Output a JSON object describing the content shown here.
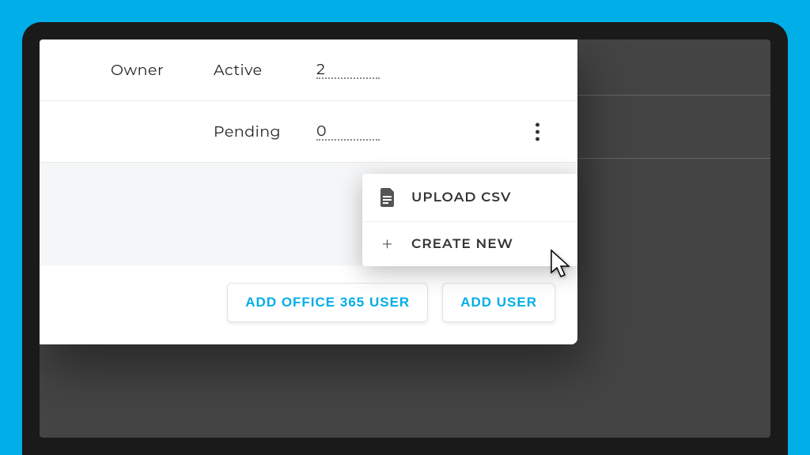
{
  "rows": [
    {
      "role": "Owner",
      "status": "Active",
      "count": "2",
      "kebab": false
    },
    {
      "role": "",
      "status": "Pending",
      "count": "0",
      "kebab": true
    }
  ],
  "dropdown": {
    "items": [
      {
        "label": "UPLOAD CSV",
        "icon": "document-icon"
      },
      {
        "label": "CREATE NEW",
        "icon": "plus-icon"
      }
    ]
  },
  "buttons": {
    "add_office": "ADD OFFICE 365 USER",
    "add_user": "ADD USER"
  },
  "colors": {
    "accent": "#00aee8",
    "frame_bg": "#444444"
  }
}
